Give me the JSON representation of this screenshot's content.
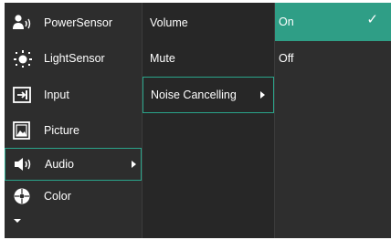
{
  "main_menu": {
    "items": [
      {
        "label": "PowerSensor",
        "icon": "power-sensor-icon"
      },
      {
        "label": "LightSensor",
        "icon": "light-sensor-icon"
      },
      {
        "label": "Input",
        "icon": "input-icon"
      },
      {
        "label": "Picture",
        "icon": "picture-icon"
      },
      {
        "label": "Audio",
        "icon": "audio-icon",
        "selected": true
      },
      {
        "label": "Color",
        "icon": "color-icon"
      }
    ]
  },
  "audio_menu": {
    "items": [
      {
        "label": "Volume"
      },
      {
        "label": "Mute"
      },
      {
        "label": "Noise Cancelling",
        "selected": true
      }
    ]
  },
  "noise_cancelling_options": {
    "items": [
      {
        "label": "On",
        "checked": true
      },
      {
        "label": "Off"
      }
    ]
  },
  "colors": {
    "accent": "#2f9e86",
    "outline": "#2aa58b",
    "panel_bg": "#2d2d2d"
  }
}
